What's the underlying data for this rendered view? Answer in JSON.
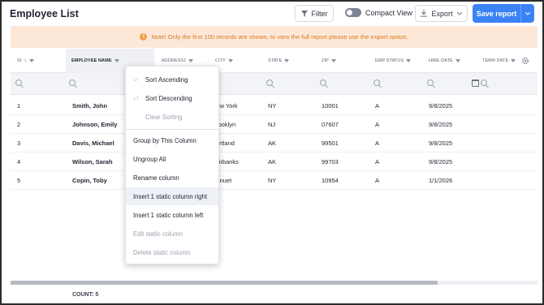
{
  "header": {
    "title": "Employee List",
    "filter_label": "Filter",
    "compact_label": "Compact View",
    "export_label": "Export",
    "save_label": "Save report"
  },
  "note": "Note! Only the first 100 records are shown, to view the full report please use the export option.",
  "columns": [
    "SI",
    "EMPLOYEE NAME",
    "ADDRESS1",
    "CITY",
    "STATE",
    "ZIP",
    "EMP STATUS",
    "HIRE DATE",
    "TERM DATE"
  ],
  "rows": [
    {
      "si": "1",
      "name": "Smith, John",
      "city": "New York",
      "state": "NY",
      "zip": "10001",
      "status": "A",
      "hire": "9/8/2025"
    },
    {
      "si": "2",
      "name": "Johnson, Emily",
      "city": "Brooklyn",
      "state": "NJ",
      "zip": "07607",
      "status": "A",
      "hire": "9/8/2025"
    },
    {
      "si": "3",
      "name": "Davis, Michael",
      "city": "Portland",
      "state": "AK",
      "zip": "99501",
      "status": "A",
      "hire": "9/8/2025"
    },
    {
      "si": "4",
      "name": "Wilson, Sarah",
      "city": "Fairbanks",
      "state": "AK",
      "zip": "99703",
      "status": "A",
      "hire": "9/8/2025"
    },
    {
      "si": "5",
      "name": "Copin, Toby",
      "city": "Nanuet",
      "state": "NY",
      "zip": "10954",
      "status": "A",
      "hire": "1/1/2026"
    }
  ],
  "menu": {
    "sort_asc": "Sort Ascending",
    "sort_desc": "Sort Descending",
    "clear_sort": "Clear Sorting",
    "group_by": "Group by This Column",
    "ungroup": "Ungroup All",
    "rename": "Rename column",
    "insert_right": "Insert 1 static column right",
    "insert_left": "Insert 1 static column left",
    "edit_static": "Edit static column",
    "delete_static": "Delete static column"
  },
  "footer": {
    "count": "COUNT: 5"
  },
  "colors": {
    "accent": "#3b82f6",
    "note_bg": "#fde8d8",
    "note_text": "#d97a20"
  },
  "icons": [
    "funnel-icon",
    "toggle-icon",
    "download-icon",
    "chevron-down-icon",
    "info-icon",
    "search-icon",
    "calendar-icon",
    "gear-icon",
    "sort-asc-icon",
    "sort-desc-icon"
  ]
}
